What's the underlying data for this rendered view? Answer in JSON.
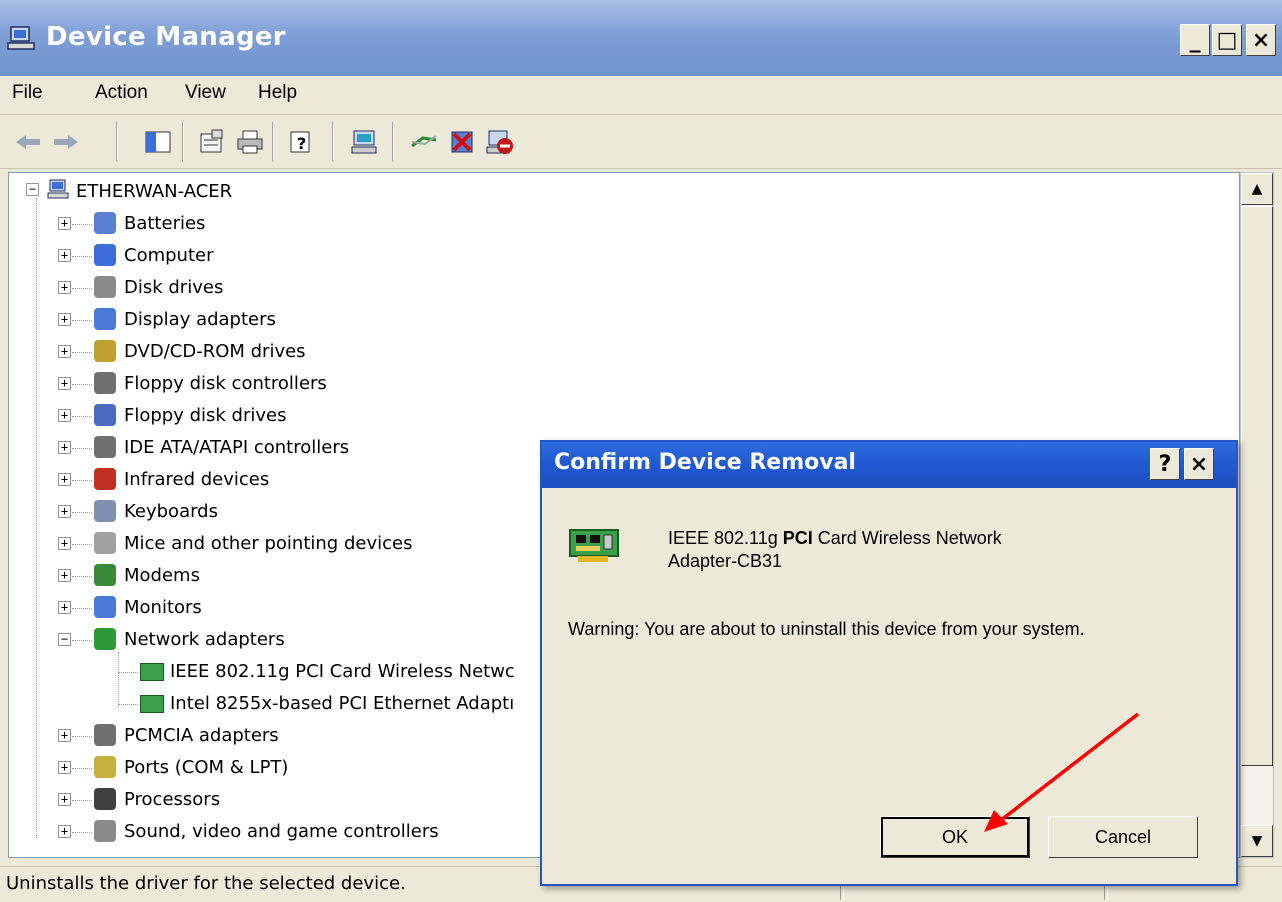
{
  "window": {
    "title": "Device Manager",
    "controls": {
      "minimize": "_",
      "maximize": "□",
      "close": "×"
    }
  },
  "menu": [
    "File",
    "Action",
    "View",
    "Help"
  ],
  "toolbar_icons": [
    "back-arrow-icon",
    "forward-arrow-icon",
    "show-hide-tree-icon",
    "properties-icon",
    "print-icon",
    "help-icon",
    "scan-hardware-icon",
    "update-driver-icon",
    "uninstall-icon",
    "disable-icon"
  ],
  "tree": {
    "root": "ETHERWAN-ACER",
    "items": [
      {
        "label": "Batteries",
        "expander": "+"
      },
      {
        "label": "Computer",
        "expander": "+"
      },
      {
        "label": "Disk drives",
        "expander": "+"
      },
      {
        "label": "Display adapters",
        "expander": "+"
      },
      {
        "label": "DVD/CD-ROM drives",
        "expander": "+"
      },
      {
        "label": "Floppy disk controllers",
        "expander": "+"
      },
      {
        "label": "Floppy disk drives",
        "expander": "+"
      },
      {
        "label": "IDE ATA/ATAPI controllers",
        "expander": "+"
      },
      {
        "label": "Infrared devices",
        "expander": "+"
      },
      {
        "label": "Keyboards",
        "expander": "+"
      },
      {
        "label": "Mice and other pointing devices",
        "expander": "+"
      },
      {
        "label": "Modems",
        "expander": "+"
      },
      {
        "label": "Monitors",
        "expander": "+"
      },
      {
        "label": "Network adapters",
        "expander": "−"
      },
      {
        "label": "PCMCIA adapters",
        "expander": "+"
      },
      {
        "label": "Ports (COM & LPT)",
        "expander": "+"
      },
      {
        "label": "Processors",
        "expander": "+"
      },
      {
        "label": "Sound, video and game controllers",
        "expander": "+"
      }
    ],
    "network_children": [
      "IEEE 802.11g PCI Card Wireless Netwc",
      "Intel 8255x-based PCI Ethernet Adaptı"
    ]
  },
  "status": "Uninstalls the driver for the selected device.",
  "dialog": {
    "title": "Confirm Device Removal",
    "help_btn": "?",
    "close_btn": "×",
    "device_name_pre": "IEEE 802.11g ",
    "device_name_bold": "PCI",
    "device_name_post": " Card Wireless Network",
    "device_name_line2": "Adapter-CB31",
    "warning": "Warning: You are about to uninstall this device from your system.",
    "ok": "OK",
    "cancel": "Cancel"
  },
  "colors": {
    "title_bar": "#7f9fd6",
    "dialog_title": "#1f58d0",
    "annotation_arrow": "#ff0000"
  }
}
